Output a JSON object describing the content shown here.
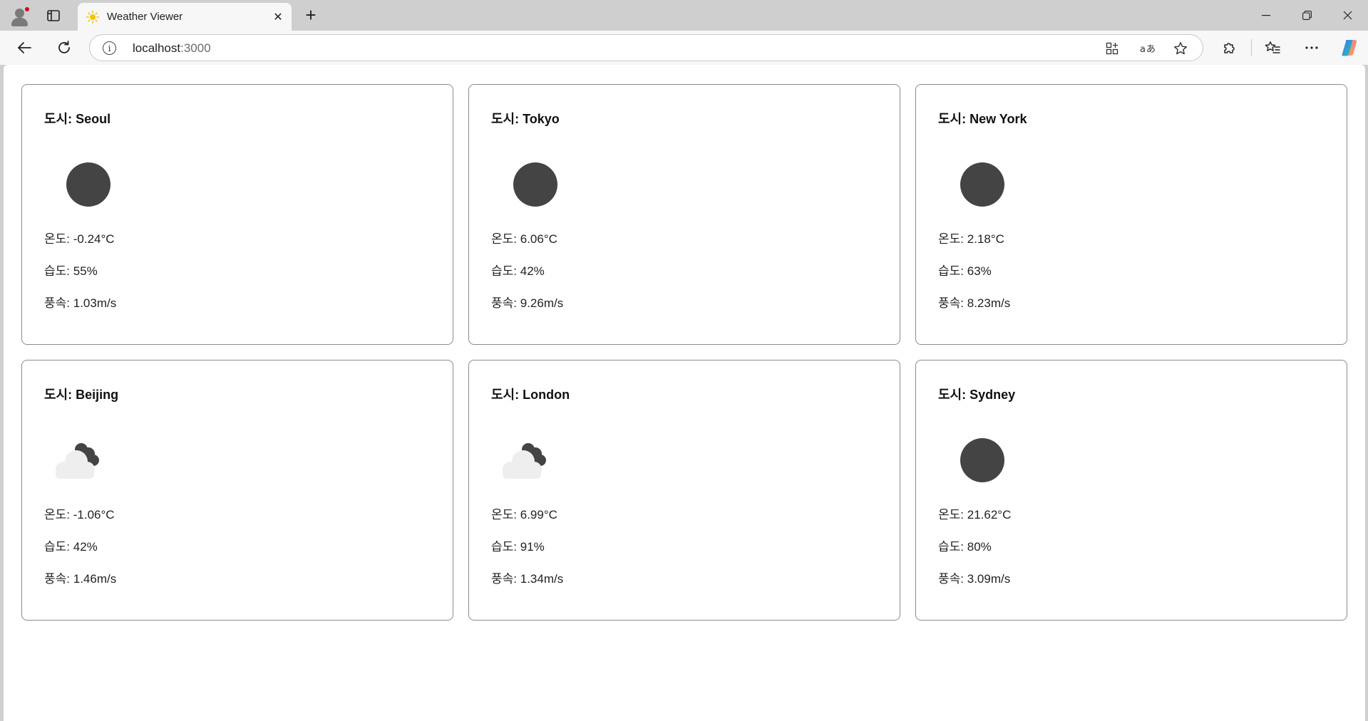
{
  "browser": {
    "tab_title": "Weather Viewer",
    "url_host": "localhost",
    "url_port": ":3000",
    "new_tab_symbol": "+",
    "close_symbol": "✕"
  },
  "labels": {
    "city": "도시: ",
    "temp": "온도: ",
    "humidity": "습도: ",
    "wind": "풍속: "
  },
  "cities": [
    {
      "name": "Seoul",
      "icon": "clear-night-icon",
      "temp": "-0.24°C",
      "humidity": "55%",
      "wind": "1.03m/s"
    },
    {
      "name": "Tokyo",
      "icon": "clear-night-icon",
      "temp": "6.06°C",
      "humidity": "42%",
      "wind": "9.26m/s"
    },
    {
      "name": "New York",
      "icon": "clear-night-icon",
      "temp": "2.18°C",
      "humidity": "63%",
      "wind": "8.23m/s"
    },
    {
      "name": "Beijing",
      "icon": "cloudy-icon",
      "temp": "-1.06°C",
      "humidity": "42%",
      "wind": "1.46m/s"
    },
    {
      "name": "London",
      "icon": "cloudy-icon",
      "temp": "6.99°C",
      "humidity": "91%",
      "wind": "1.34m/s"
    },
    {
      "name": "Sydney",
      "icon": "clear-night-icon",
      "temp": "21.62°C",
      "humidity": "80%",
      "wind": "3.09m/s"
    }
  ],
  "colors": {
    "icon_dark": "#444444",
    "cloud_light": "#eeeeee",
    "card_border": "#8c8c8c",
    "favicon_sun": "#f5c400"
  }
}
